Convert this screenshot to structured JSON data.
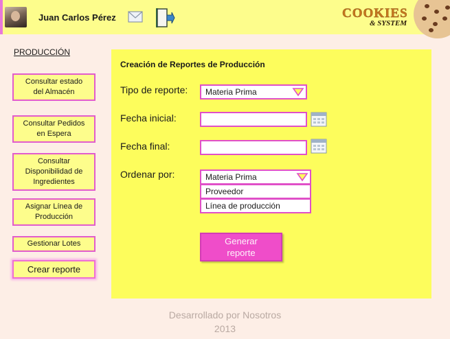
{
  "header": {
    "user_name": "Juan Carlos Pérez",
    "logo_text_top": "COOKIES",
    "logo_text_bottom": "& SYSTEM"
  },
  "sidebar": {
    "section_title": "PRODUCCIÓN",
    "items": [
      {
        "label": "Consultar estado del Almacén"
      },
      {
        "label": "Consultar Pedidos en Espera"
      },
      {
        "label": "Consultar Disponibilidad de Ingredientes"
      },
      {
        "label": "Asignar Línea de Producción"
      },
      {
        "label": "Gestionar Lotes"
      },
      {
        "label": "Crear reporte"
      }
    ]
  },
  "form": {
    "title": "Creación de Reportes de Producción",
    "tipo_label": "Tipo de reporte:",
    "tipo_value": "Materia Prima",
    "fecha_inicial_label": "Fecha inicial:",
    "fecha_inicial_value": "",
    "fecha_final_label": "Fecha final:",
    "fecha_final_value": "",
    "ordenar_label": "Ordenar por:",
    "ordenar_value": "Materia Prima",
    "ordenar_options": [
      "Proveedor",
      "Línea de producción"
    ],
    "generate_label": "Generar reporte"
  },
  "footer": {
    "line1": "Desarrollado por Nosotros",
    "line2": "2013"
  },
  "colors": {
    "accent": "#e04fc8",
    "button": "#ef4dc9",
    "panel": "#fdfd5c",
    "header": "#fdfd8c",
    "background": "#fdeee6"
  }
}
